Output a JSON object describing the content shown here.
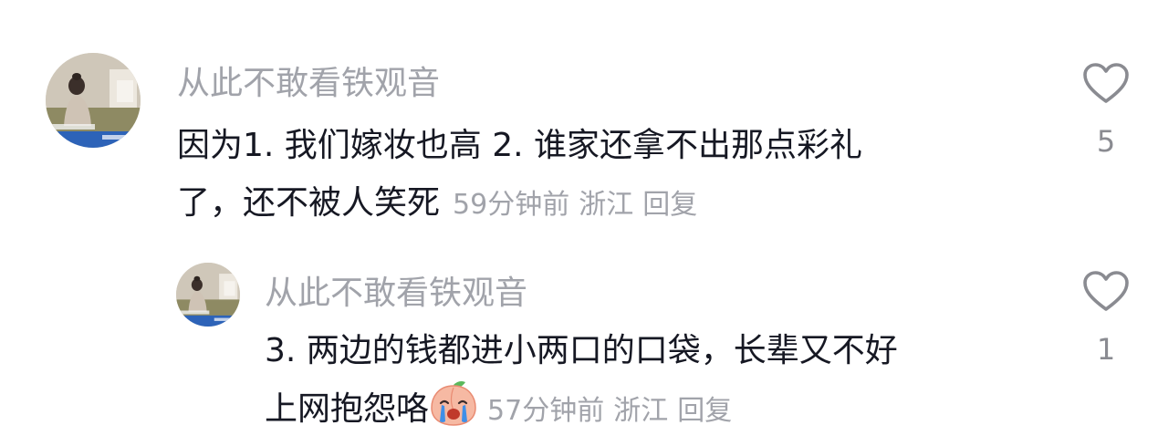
{
  "comments": [
    {
      "username": "从此不敢看铁观音",
      "text_line1": "因为1. 我们嫁妆也高 2. 谁家还拿不出那点彩礼",
      "text_line2": "了，还不被人笑死",
      "time": "59分钟前",
      "location": "浙江",
      "reply_label": "回复",
      "like_count": "5",
      "avatar_icon": "user-avatar-photo",
      "like_icon": "heart-outline-icon"
    },
    {
      "username": "从此不敢看铁观音",
      "text_line1": "3. 两边的钱都进小两口的口袋，长辈又不好",
      "text_line2": "上网抱怨咯",
      "emoji": "crying-peach-emoji",
      "time": "57分钟前",
      "location": "浙江",
      "reply_label": "回复",
      "like_count": "1",
      "avatar_icon": "user-avatar-photo",
      "like_icon": "heart-outline-icon"
    }
  ],
  "colors": {
    "text_primary": "#161823",
    "text_secondary": "#a1a3aa",
    "like_icon": "#8a8b91"
  }
}
